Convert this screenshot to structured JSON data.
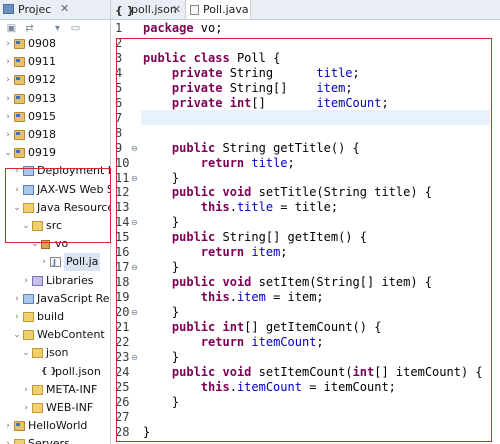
{
  "explorer": {
    "title": "Projec",
    "close": "✕",
    "toolbar_icons": [
      "collapse-all-icon",
      "link-editor-icon",
      "view-menu-icon",
      "minimize-icon"
    ],
    "tree": [
      {
        "label": "0908",
        "arrow": "›",
        "icon": "project",
        "depth": 0
      },
      {
        "label": "0911",
        "arrow": "›",
        "icon": "project",
        "depth": 0
      },
      {
        "label": "0912",
        "arrow": "›",
        "icon": "project",
        "depth": 0
      },
      {
        "label": "0913",
        "arrow": "›",
        "icon": "project",
        "depth": 0
      },
      {
        "label": "0915",
        "arrow": "›",
        "icon": "project",
        "depth": 0
      },
      {
        "label": "0918",
        "arrow": "›",
        "icon": "project",
        "depth": 0
      },
      {
        "label": "0919",
        "arrow": "⌄",
        "icon": "project",
        "depth": 0
      },
      {
        "label": "Deployment D",
        "arrow": "›",
        "icon": "generic",
        "depth": 1
      },
      {
        "label": "JAX-WS Web S",
        "arrow": "›",
        "icon": "generic",
        "depth": 1
      },
      {
        "label": "Java Resources",
        "arrow": "⌄",
        "icon": "folder",
        "depth": 1
      },
      {
        "label": "src",
        "arrow": "⌄",
        "icon": "folder",
        "depth": 2
      },
      {
        "label": "vo",
        "arrow": "⌄",
        "icon": "package",
        "depth": 3
      },
      {
        "label": "Poll.ja",
        "arrow": "›",
        "icon": "java",
        "depth": 4
      },
      {
        "label": "Libraries",
        "arrow": "›",
        "icon": "library",
        "depth": 2
      },
      {
        "label": "JavaScript Resc",
        "arrow": "›",
        "icon": "generic",
        "depth": 1
      },
      {
        "label": "build",
        "arrow": "›",
        "icon": "folder",
        "depth": 1
      },
      {
        "label": "WebContent",
        "arrow": "⌄",
        "icon": "folder",
        "depth": 1
      },
      {
        "label": "json",
        "arrow": "⌄",
        "icon": "folder",
        "depth": 2
      },
      {
        "label": "poll.json",
        "arrow": "",
        "icon": "json",
        "depth": 3
      },
      {
        "label": "META-INF",
        "arrow": "›",
        "icon": "folder",
        "depth": 2
      },
      {
        "label": "WEB-INF",
        "arrow": "›",
        "icon": "folder",
        "depth": 2
      },
      {
        "label": "HelloWorld",
        "arrow": "›",
        "icon": "project",
        "depth": 0
      },
      {
        "label": "Servers",
        "arrow": "›",
        "icon": "folder",
        "depth": 0
      }
    ]
  },
  "editor": {
    "tabs": [
      {
        "label": "poll.json",
        "icon": "{ }",
        "close": "✕",
        "active": false
      },
      {
        "label": "Poll.java",
        "icon": "java",
        "close": "✕",
        "active": true
      }
    ],
    "line_numbers": [
      "1",
      "2",
      "3",
      "4",
      "5",
      "6",
      "7",
      "8",
      "9",
      "10",
      "11",
      "12",
      "13",
      "14",
      "15",
      "16",
      "17",
      "18",
      "19",
      "20",
      "21",
      "22",
      "23",
      "24",
      "25",
      "26",
      "27",
      "28"
    ],
    "fold_markers": {
      "9": "⊖",
      "11": "⊖",
      "14": "⊖",
      "17": "⊖",
      "20": "⊖",
      "23": "⊖"
    },
    "lines": [
      [
        {
          "t": "package",
          "c": "kw"
        },
        {
          "t": " vo;",
          "c": ""
        }
      ],
      [],
      [
        {
          "t": "public",
          "c": "kw"
        },
        {
          "t": " ",
          "c": ""
        },
        {
          "t": "class",
          "c": "kw"
        },
        {
          "t": " Poll {",
          "c": ""
        }
      ],
      [
        {
          "t": "    ",
          "c": ""
        },
        {
          "t": "private",
          "c": "kw"
        },
        {
          "t": " String      ",
          "c": ""
        },
        {
          "t": "title",
          "c": "fld"
        },
        {
          "t": ";",
          "c": ""
        }
      ],
      [
        {
          "t": "    ",
          "c": ""
        },
        {
          "t": "private",
          "c": "kw"
        },
        {
          "t": " String[]    ",
          "c": ""
        },
        {
          "t": "item",
          "c": "fld"
        },
        {
          "t": ";",
          "c": ""
        }
      ],
      [
        {
          "t": "    ",
          "c": ""
        },
        {
          "t": "private",
          "c": "kw"
        },
        {
          "t": " ",
          "c": ""
        },
        {
          "t": "int",
          "c": "kw"
        },
        {
          "t": "[]       ",
          "c": ""
        },
        {
          "t": "itemCount",
          "c": "fld"
        },
        {
          "t": ";",
          "c": ""
        }
      ],
      [],
      [],
      [
        {
          "t": "    ",
          "c": ""
        },
        {
          "t": "public",
          "c": "kw"
        },
        {
          "t": " String getTitle() {",
          "c": ""
        }
      ],
      [
        {
          "t": "        ",
          "c": ""
        },
        {
          "t": "return",
          "c": "kw"
        },
        {
          "t": " ",
          "c": ""
        },
        {
          "t": "title",
          "c": "fld"
        },
        {
          "t": ";",
          "c": ""
        }
      ],
      [
        {
          "t": "    }",
          "c": ""
        }
      ],
      [
        {
          "t": "    ",
          "c": ""
        },
        {
          "t": "public",
          "c": "kw"
        },
        {
          "t": " ",
          "c": ""
        },
        {
          "t": "void",
          "c": "kw"
        },
        {
          "t": " setTitle(String title) {",
          "c": ""
        }
      ],
      [
        {
          "t": "        ",
          "c": ""
        },
        {
          "t": "this",
          "c": "kw"
        },
        {
          "t": ".",
          "c": ""
        },
        {
          "t": "title",
          "c": "fld"
        },
        {
          "t": " = title;",
          "c": ""
        }
      ],
      [
        {
          "t": "    }",
          "c": ""
        }
      ],
      [
        {
          "t": "    ",
          "c": ""
        },
        {
          "t": "public",
          "c": "kw"
        },
        {
          "t": " String[] getItem() {",
          "c": ""
        }
      ],
      [
        {
          "t": "        ",
          "c": ""
        },
        {
          "t": "return",
          "c": "kw"
        },
        {
          "t": " ",
          "c": ""
        },
        {
          "t": "item",
          "c": "fld"
        },
        {
          "t": ";",
          "c": ""
        }
      ],
      [
        {
          "t": "    }",
          "c": ""
        }
      ],
      [
        {
          "t": "    ",
          "c": ""
        },
        {
          "t": "public",
          "c": "kw"
        },
        {
          "t": " ",
          "c": ""
        },
        {
          "t": "void",
          "c": "kw"
        },
        {
          "t": " setItem(String[] item) {",
          "c": ""
        }
      ],
      [
        {
          "t": "        ",
          "c": ""
        },
        {
          "t": "this",
          "c": "kw"
        },
        {
          "t": ".",
          "c": ""
        },
        {
          "t": "item",
          "c": "fld"
        },
        {
          "t": " = item;",
          "c": ""
        }
      ],
      [
        {
          "t": "    }",
          "c": ""
        }
      ],
      [
        {
          "t": "    ",
          "c": ""
        },
        {
          "t": "public",
          "c": "kw"
        },
        {
          "t": " ",
          "c": ""
        },
        {
          "t": "int",
          "c": "kw"
        },
        {
          "t": "[] getItemCount() {",
          "c": ""
        }
      ],
      [
        {
          "t": "        ",
          "c": ""
        },
        {
          "t": "return",
          "c": "kw"
        },
        {
          "t": " ",
          "c": ""
        },
        {
          "t": "itemCount",
          "c": "fld"
        },
        {
          "t": ";",
          "c": ""
        }
      ],
      [
        {
          "t": "    }",
          "c": ""
        }
      ],
      [
        {
          "t": "    ",
          "c": ""
        },
        {
          "t": "public",
          "c": "kw"
        },
        {
          "t": " ",
          "c": ""
        },
        {
          "t": "void",
          "c": "kw"
        },
        {
          "t": " setItemCount(",
          "c": ""
        },
        {
          "t": "int",
          "c": "kw"
        },
        {
          "t": "[] itemCount) {",
          "c": ""
        }
      ],
      [
        {
          "t": "        ",
          "c": ""
        },
        {
          "t": "this",
          "c": "kw"
        },
        {
          "t": ".",
          "c": ""
        },
        {
          "t": "itemCount",
          "c": "fld"
        },
        {
          "t": " = itemCount;",
          "c": ""
        }
      ],
      [
        {
          "t": "    }",
          "c": ""
        }
      ],
      [],
      [
        {
          "t": "}",
          "c": ""
        }
      ]
    ]
  },
  "colors": {
    "keyword": "#7f0055",
    "field": "#0000c0",
    "annotation_box": "#d32b2b",
    "current_line": "#e8f2fe"
  }
}
